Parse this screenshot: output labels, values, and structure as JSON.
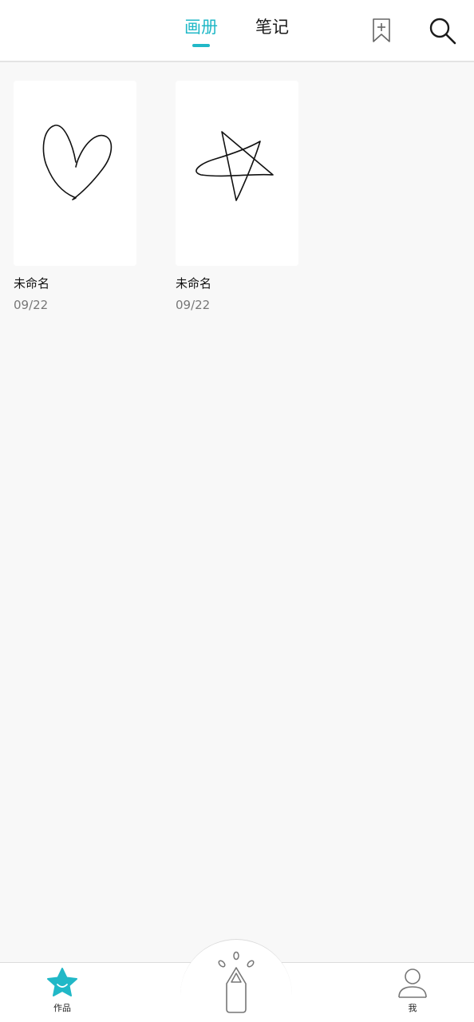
{
  "header": {
    "tabs": [
      {
        "label": "画册",
        "active": true
      },
      {
        "label": "笔记",
        "active": false
      }
    ],
    "icons": {
      "bookmark": "bookmark-add-icon",
      "search": "search-icon"
    }
  },
  "works": [
    {
      "title": "未命名",
      "date": "09/22",
      "thumbnail": "heart-sketch"
    },
    {
      "title": "未命名",
      "date": "09/22",
      "thumbnail": "star-sketch"
    }
  ],
  "bottom_nav": {
    "items": [
      {
        "label": "作品",
        "icon": "star-smile-icon",
        "active": true
      },
      {
        "label": "",
        "icon": "pencil-create-icon",
        "active": false
      },
      {
        "label": "我",
        "icon": "person-icon",
        "active": false
      }
    ]
  },
  "colors": {
    "accent": "#21b8c7",
    "background": "#f8f8f8",
    "text": "#111111",
    "muted": "#777777"
  }
}
